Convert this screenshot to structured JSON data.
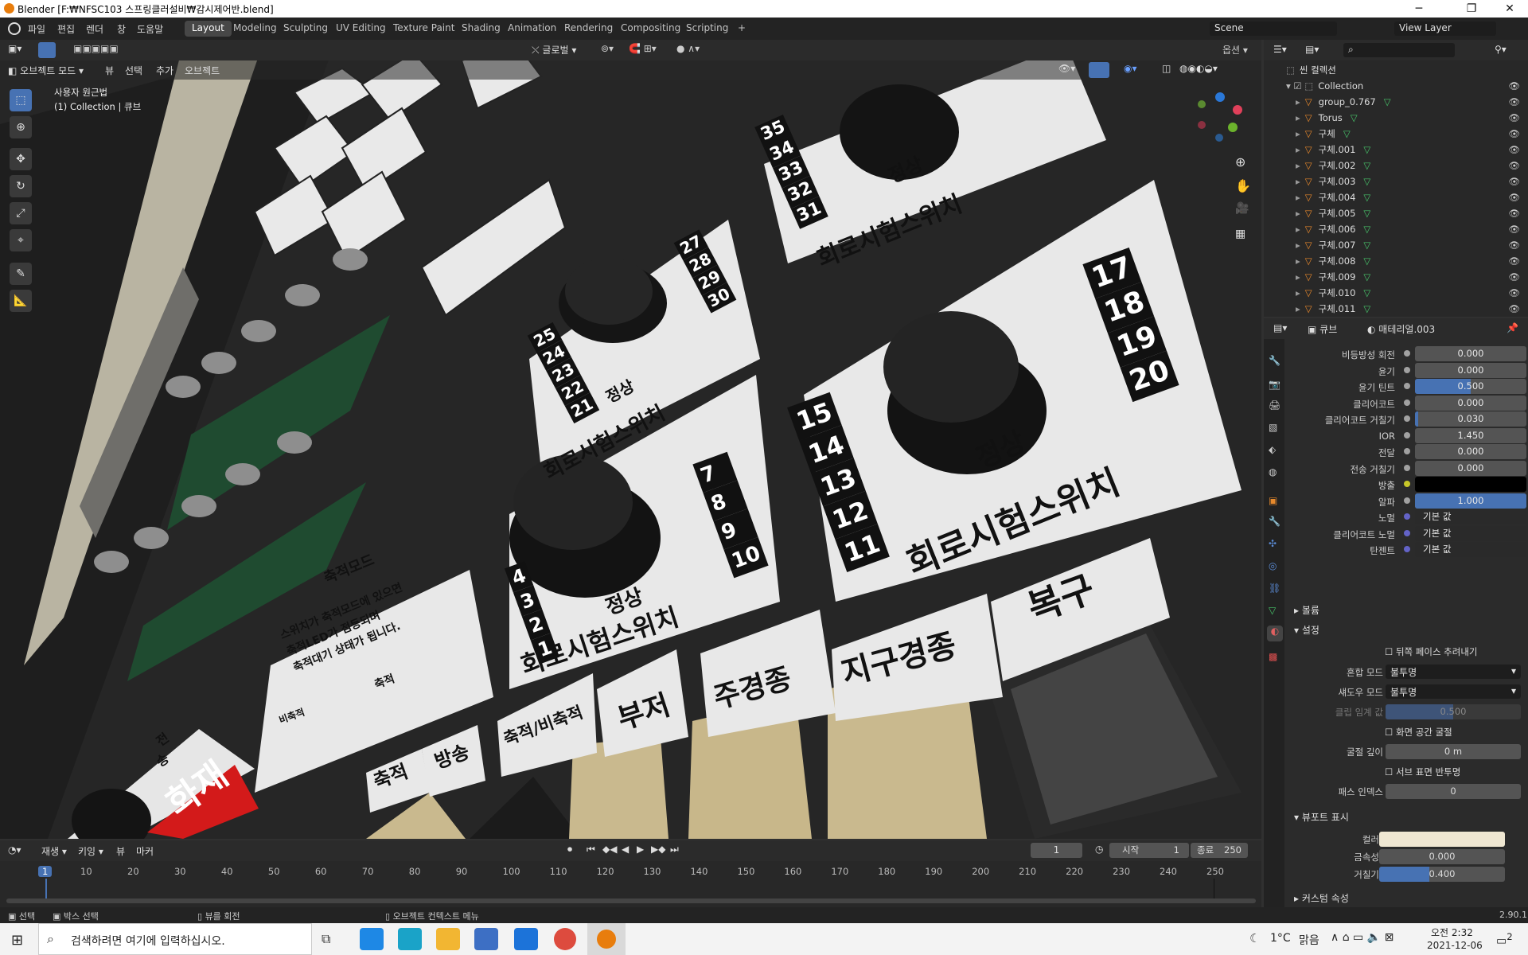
{
  "window": {
    "title": "Blender [F:₩NFSC103 스프링클러설비₩감시제어반.blend]"
  },
  "menus": [
    "파일",
    "편집",
    "렌더",
    "창",
    "도움말"
  ],
  "workspaces": [
    "Layout",
    "Modeling",
    "Sculpting",
    "UV Editing",
    "Texture Paint",
    "Shading",
    "Animation",
    "Rendering",
    "Compositing",
    "Scripting",
    "+"
  ],
  "scene": {
    "label": "Scene",
    "view_layer": "View Layer"
  },
  "viewport": {
    "mode": "오브젝트 모드",
    "view": "뷰",
    "select": "선택",
    "add": "추가",
    "object": "오브젝트",
    "transform": "글로벌",
    "options": "옵션",
    "overlay_line1": "사용자 원근법",
    "overlay_line2": "(1) Collection | 큐브",
    "panel_labels": [
      "회로시험스위치",
      "회로시험스위치",
      "회로시험스위치",
      "회로시험스위치"
    ],
    "normal": "정상",
    "dial_numbers_a": [
      "25",
      "24",
      "23",
      "22",
      "21",
      "27",
      "28",
      "29",
      "30"
    ],
    "dial_numbers_b": [
      "35",
      "34",
      "33",
      "32",
      "31"
    ],
    "dial_numbers_c": [
      "15",
      "14",
      "13",
      "12",
      "11",
      "17",
      "18",
      "19",
      "20"
    ],
    "dial_numbers_d": [
      "1",
      "2",
      "3",
      "4",
      "7",
      "8",
      "9",
      "10"
    ],
    "buttons": [
      "축적",
      "방송",
      "축적/비축적",
      "부저",
      "주경종",
      "지구경종",
      "복구"
    ],
    "sign_title": "축적모드",
    "sign_text": [
      "스위치가 축적모드에 있으면",
      "축적LED가 점등되며",
      "축적대기 상태가 됩니다."
    ],
    "sign_labels": [
      "비축적",
      "축적"
    ],
    "fire": "화재",
    "switch_labels": [
      "전",
      "송"
    ]
  },
  "outliner": {
    "root": "씬 컬렉션",
    "collection": "Collection",
    "items": [
      "group_0.767",
      "Torus",
      "구체",
      "구체.001",
      "구체.002",
      "구체.003",
      "구체.004",
      "구체.005",
      "구체.006",
      "구체.007",
      "구체.008",
      "구체.009",
      "구체.010",
      "구체.011"
    ]
  },
  "properties": {
    "object": "큐브",
    "material": "매테리얼.003",
    "rows": [
      {
        "label": "비등방성 회전",
        "value": "0.000",
        "fill": 0
      },
      {
        "label": "윤기",
        "value": "0.000",
        "fill": 0
      },
      {
        "label": "윤기 틴트",
        "value": "0.500",
        "fill": 0.5
      },
      {
        "label": "클리어코트",
        "value": "0.000",
        "fill": 0
      },
      {
        "label": "클리어코트 거칠기",
        "value": "0.030",
        "fill": 0.03
      },
      {
        "label": "IOR",
        "value": "1.450",
        "fill": 0
      },
      {
        "label": "전달",
        "value": "0.000",
        "fill": 0
      },
      {
        "label": "전송 거칠기",
        "value": "0.000",
        "fill": 0
      },
      {
        "label": "방출",
        "value": "",
        "fill": 0
      },
      {
        "label": "알파",
        "value": "1.000",
        "fill": 1
      },
      {
        "label": "노멀",
        "value": "기본 값",
        "fill": 0
      },
      {
        "label": "클리어코트 노멀",
        "value": "기본 값",
        "fill": 0
      },
      {
        "label": "탄젠트",
        "value": "기본 값",
        "fill": 0
      }
    ],
    "sections": {
      "volume": "볼륨",
      "settings": "설정",
      "viewport_display": "뷰포트 표시",
      "custom": "커스텀 속성"
    },
    "backface": "뒤쪽 페이스 추려내기",
    "blend_mode_label": "혼합 모드",
    "blend_mode": "불투명",
    "shadow_mode_label": "섀도우 모드",
    "shadow_mode": "불투명",
    "clip_label": "클립 임계 값",
    "clip_value": "0.500",
    "screen_refraction": "화면 공간 굴절",
    "refraction_depth_label": "굴절 깊이",
    "refraction_depth": "0 m",
    "subsurface": "서브 표면 반투명",
    "pass_index_label": "패스 인덱스",
    "pass_index": "0",
    "color_label": "컬러",
    "metallic_label": "금속성",
    "metallic": "0.000",
    "roughness_label": "거칠기",
    "roughness": "0.400"
  },
  "timeline": {
    "play": "재생",
    "keying": "키잉",
    "view": "뷰",
    "marker": "마커",
    "current": "1",
    "start_label": "시작",
    "start": "1",
    "end_label": "종료",
    "end": "250",
    "ticks": [
      "1",
      "10",
      "20",
      "30",
      "40",
      "50",
      "60",
      "70",
      "80",
      "90",
      "100",
      "110",
      "120",
      "130",
      "140",
      "150",
      "160",
      "170",
      "180",
      "190",
      "200",
      "210",
      "220",
      "230",
      "240",
      "250"
    ]
  },
  "status": {
    "select": "선택",
    "box": "박스 선택",
    "rotate": "뷰를 회전",
    "context": "오브젝트 컨텍스트 메뉴",
    "version": "2.90.1"
  },
  "taskbar": {
    "search": "검색하려면 여기에 입력하십시오.",
    "temp": "1°C",
    "weather": "맑음",
    "time": "오전 2:32",
    "date": "2021-12-06",
    "notif": "2"
  }
}
